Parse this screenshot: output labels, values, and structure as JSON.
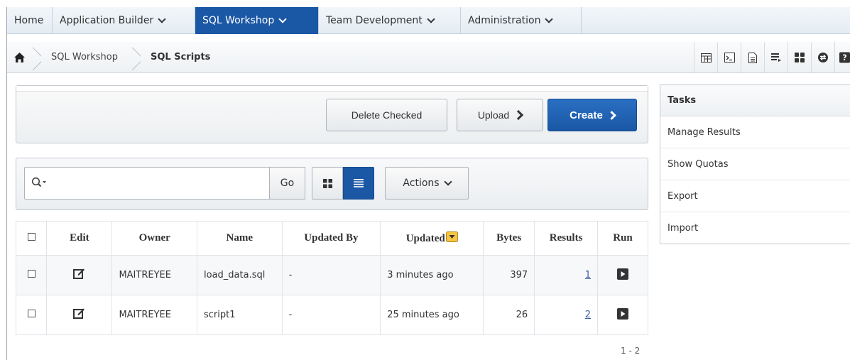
{
  "topnav": {
    "tabs": [
      {
        "label": "Home",
        "dropdown": false,
        "active": false
      },
      {
        "label": "Application Builder",
        "dropdown": true,
        "active": false
      },
      {
        "label": "SQL Workshop",
        "dropdown": true,
        "active": true
      },
      {
        "label": "Team Development",
        "dropdown": true,
        "active": false
      },
      {
        "label": "Administration",
        "dropdown": true,
        "active": false
      }
    ]
  },
  "breadcrumb": {
    "items": [
      "SQL Workshop",
      "SQL Scripts"
    ]
  },
  "toolbar_icons": [
    "object-browser-icon",
    "sql-commands-icon",
    "sql-scripts-icon",
    "query-builder-icon",
    "utilities-icon",
    "restful-services-icon",
    "help-icon"
  ],
  "buttons": {
    "delete_checked": "Delete Checked",
    "upload": "Upload",
    "create": "Create"
  },
  "search": {
    "placeholder": "",
    "value": "",
    "go_label": "Go",
    "actions_label": "Actions"
  },
  "table": {
    "headers": [
      "Edit",
      "Owner",
      "Name",
      "Updated By",
      "Updated",
      "Bytes",
      "Results",
      "Run"
    ],
    "rows": [
      {
        "owner": "MAITREYEE",
        "name": "load_data.sql",
        "updated_by": "-",
        "updated": "3 minutes ago",
        "bytes": "397",
        "results": "1"
      },
      {
        "owner": "MAITREYEE",
        "name": "script1",
        "updated_by": "-",
        "updated": "25 minutes ago",
        "bytes": "26",
        "results": "2"
      }
    ],
    "pagination": "1 - 2"
  },
  "tasks": {
    "title": "Tasks",
    "items": [
      "Manage Results",
      "Show Quotas",
      "Export",
      "Import"
    ]
  },
  "colors": {
    "accent": "#1a57a5",
    "link": "#3c5ea8"
  }
}
